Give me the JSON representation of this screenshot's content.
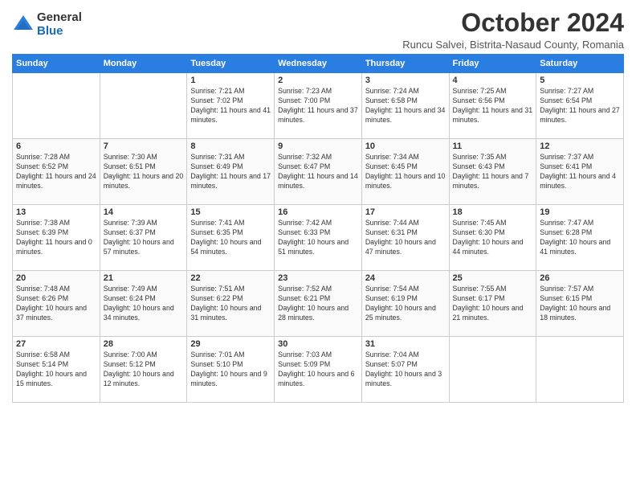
{
  "logo": {
    "general": "General",
    "blue": "Blue"
  },
  "header": {
    "month": "October 2024",
    "location": "Runcu Salvei, Bistrita-Nasaud County, Romania"
  },
  "weekdays": [
    "Sunday",
    "Monday",
    "Tuesday",
    "Wednesday",
    "Thursday",
    "Friday",
    "Saturday"
  ],
  "weeks": [
    [
      {
        "day": "",
        "info": ""
      },
      {
        "day": "",
        "info": ""
      },
      {
        "day": "1",
        "info": "Sunrise: 7:21 AM\nSunset: 7:02 PM\nDaylight: 11 hours and 41 minutes."
      },
      {
        "day": "2",
        "info": "Sunrise: 7:23 AM\nSunset: 7:00 PM\nDaylight: 11 hours and 37 minutes."
      },
      {
        "day": "3",
        "info": "Sunrise: 7:24 AM\nSunset: 6:58 PM\nDaylight: 11 hours and 34 minutes."
      },
      {
        "day": "4",
        "info": "Sunrise: 7:25 AM\nSunset: 6:56 PM\nDaylight: 11 hours and 31 minutes."
      },
      {
        "day": "5",
        "info": "Sunrise: 7:27 AM\nSunset: 6:54 PM\nDaylight: 11 hours and 27 minutes."
      }
    ],
    [
      {
        "day": "6",
        "info": "Sunrise: 7:28 AM\nSunset: 6:52 PM\nDaylight: 11 hours and 24 minutes."
      },
      {
        "day": "7",
        "info": "Sunrise: 7:30 AM\nSunset: 6:51 PM\nDaylight: 11 hours and 20 minutes."
      },
      {
        "day": "8",
        "info": "Sunrise: 7:31 AM\nSunset: 6:49 PM\nDaylight: 11 hours and 17 minutes."
      },
      {
        "day": "9",
        "info": "Sunrise: 7:32 AM\nSunset: 6:47 PM\nDaylight: 11 hours and 14 minutes."
      },
      {
        "day": "10",
        "info": "Sunrise: 7:34 AM\nSunset: 6:45 PM\nDaylight: 11 hours and 10 minutes."
      },
      {
        "day": "11",
        "info": "Sunrise: 7:35 AM\nSunset: 6:43 PM\nDaylight: 11 hours and 7 minutes."
      },
      {
        "day": "12",
        "info": "Sunrise: 7:37 AM\nSunset: 6:41 PM\nDaylight: 11 hours and 4 minutes."
      }
    ],
    [
      {
        "day": "13",
        "info": "Sunrise: 7:38 AM\nSunset: 6:39 PM\nDaylight: 11 hours and 0 minutes."
      },
      {
        "day": "14",
        "info": "Sunrise: 7:39 AM\nSunset: 6:37 PM\nDaylight: 10 hours and 57 minutes."
      },
      {
        "day": "15",
        "info": "Sunrise: 7:41 AM\nSunset: 6:35 PM\nDaylight: 10 hours and 54 minutes."
      },
      {
        "day": "16",
        "info": "Sunrise: 7:42 AM\nSunset: 6:33 PM\nDaylight: 10 hours and 51 minutes."
      },
      {
        "day": "17",
        "info": "Sunrise: 7:44 AM\nSunset: 6:31 PM\nDaylight: 10 hours and 47 minutes."
      },
      {
        "day": "18",
        "info": "Sunrise: 7:45 AM\nSunset: 6:30 PM\nDaylight: 10 hours and 44 minutes."
      },
      {
        "day": "19",
        "info": "Sunrise: 7:47 AM\nSunset: 6:28 PM\nDaylight: 10 hours and 41 minutes."
      }
    ],
    [
      {
        "day": "20",
        "info": "Sunrise: 7:48 AM\nSunset: 6:26 PM\nDaylight: 10 hours and 37 minutes."
      },
      {
        "day": "21",
        "info": "Sunrise: 7:49 AM\nSunset: 6:24 PM\nDaylight: 10 hours and 34 minutes."
      },
      {
        "day": "22",
        "info": "Sunrise: 7:51 AM\nSunset: 6:22 PM\nDaylight: 10 hours and 31 minutes."
      },
      {
        "day": "23",
        "info": "Sunrise: 7:52 AM\nSunset: 6:21 PM\nDaylight: 10 hours and 28 minutes."
      },
      {
        "day": "24",
        "info": "Sunrise: 7:54 AM\nSunset: 6:19 PM\nDaylight: 10 hours and 25 minutes."
      },
      {
        "day": "25",
        "info": "Sunrise: 7:55 AM\nSunset: 6:17 PM\nDaylight: 10 hours and 21 minutes."
      },
      {
        "day": "26",
        "info": "Sunrise: 7:57 AM\nSunset: 6:15 PM\nDaylight: 10 hours and 18 minutes."
      }
    ],
    [
      {
        "day": "27",
        "info": "Sunrise: 6:58 AM\nSunset: 5:14 PM\nDaylight: 10 hours and 15 minutes."
      },
      {
        "day": "28",
        "info": "Sunrise: 7:00 AM\nSunset: 5:12 PM\nDaylight: 10 hours and 12 minutes."
      },
      {
        "day": "29",
        "info": "Sunrise: 7:01 AM\nSunset: 5:10 PM\nDaylight: 10 hours and 9 minutes."
      },
      {
        "day": "30",
        "info": "Sunrise: 7:03 AM\nSunset: 5:09 PM\nDaylight: 10 hours and 6 minutes."
      },
      {
        "day": "31",
        "info": "Sunrise: 7:04 AM\nSunset: 5:07 PM\nDaylight: 10 hours and 3 minutes."
      },
      {
        "day": "",
        "info": ""
      },
      {
        "day": "",
        "info": ""
      }
    ]
  ]
}
